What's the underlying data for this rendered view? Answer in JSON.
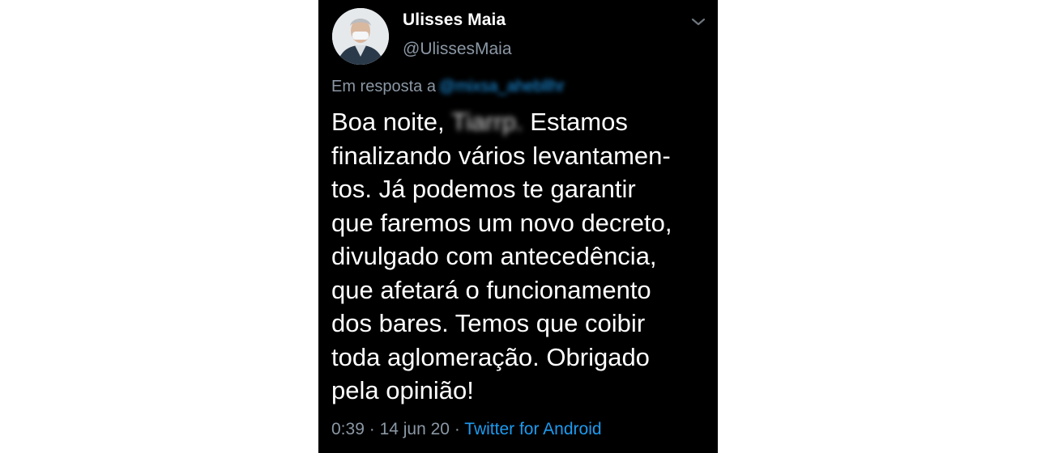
{
  "tweet": {
    "author": {
      "name": "Ulisses Maia",
      "handle": "@UlissesMaia"
    },
    "reply": {
      "label": "Em resposta a",
      "handle": "@mixsa_ahebllhr"
    },
    "text": {
      "line1_prefix": "Boa noite,",
      "line1_redacted": "Tiarrp.",
      "line1_suffix": "Estamos",
      "lines": [
        "finalizando vários levantamen-",
        "tos. Já podemos te garantir",
        "que faremos um novo decreto,",
        "divulgado com antecedência,",
        "que afetará o funcionamento",
        "dos bares. Temos que coibir",
        "toda aglomeração. Obrigado",
        "pela opinião!"
      ]
    },
    "meta": {
      "time": "0:39",
      "separator": "·",
      "date": "14 jun 20",
      "source": "Twitter for Android"
    },
    "icons": {
      "avatar": "profile-photo",
      "menu": "chevron-down-icon"
    },
    "colors": {
      "background": "#000000",
      "text": "#ffffff",
      "secondary": "#8b98a5",
      "link": "#1d9bf0"
    }
  }
}
